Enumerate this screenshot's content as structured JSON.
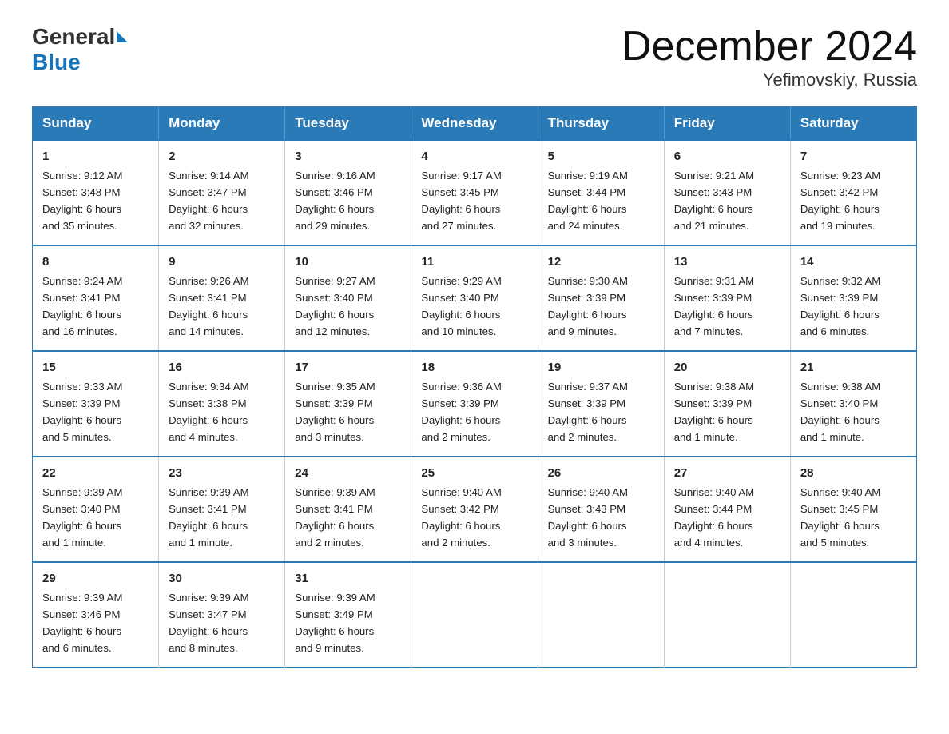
{
  "header": {
    "logo_general": "General",
    "logo_blue": "Blue",
    "month_title": "December 2024",
    "location": "Yefimovskiy, Russia"
  },
  "days_of_week": [
    "Sunday",
    "Monday",
    "Tuesday",
    "Wednesday",
    "Thursday",
    "Friday",
    "Saturday"
  ],
  "weeks": [
    [
      {
        "day": "1",
        "info": "Sunrise: 9:12 AM\nSunset: 3:48 PM\nDaylight: 6 hours\nand 35 minutes."
      },
      {
        "day": "2",
        "info": "Sunrise: 9:14 AM\nSunset: 3:47 PM\nDaylight: 6 hours\nand 32 minutes."
      },
      {
        "day": "3",
        "info": "Sunrise: 9:16 AM\nSunset: 3:46 PM\nDaylight: 6 hours\nand 29 minutes."
      },
      {
        "day": "4",
        "info": "Sunrise: 9:17 AM\nSunset: 3:45 PM\nDaylight: 6 hours\nand 27 minutes."
      },
      {
        "day": "5",
        "info": "Sunrise: 9:19 AM\nSunset: 3:44 PM\nDaylight: 6 hours\nand 24 minutes."
      },
      {
        "day": "6",
        "info": "Sunrise: 9:21 AM\nSunset: 3:43 PM\nDaylight: 6 hours\nand 21 minutes."
      },
      {
        "day": "7",
        "info": "Sunrise: 9:23 AM\nSunset: 3:42 PM\nDaylight: 6 hours\nand 19 minutes."
      }
    ],
    [
      {
        "day": "8",
        "info": "Sunrise: 9:24 AM\nSunset: 3:41 PM\nDaylight: 6 hours\nand 16 minutes."
      },
      {
        "day": "9",
        "info": "Sunrise: 9:26 AM\nSunset: 3:41 PM\nDaylight: 6 hours\nand 14 minutes."
      },
      {
        "day": "10",
        "info": "Sunrise: 9:27 AM\nSunset: 3:40 PM\nDaylight: 6 hours\nand 12 minutes."
      },
      {
        "day": "11",
        "info": "Sunrise: 9:29 AM\nSunset: 3:40 PM\nDaylight: 6 hours\nand 10 minutes."
      },
      {
        "day": "12",
        "info": "Sunrise: 9:30 AM\nSunset: 3:39 PM\nDaylight: 6 hours\nand 9 minutes."
      },
      {
        "day": "13",
        "info": "Sunrise: 9:31 AM\nSunset: 3:39 PM\nDaylight: 6 hours\nand 7 minutes."
      },
      {
        "day": "14",
        "info": "Sunrise: 9:32 AM\nSunset: 3:39 PM\nDaylight: 6 hours\nand 6 minutes."
      }
    ],
    [
      {
        "day": "15",
        "info": "Sunrise: 9:33 AM\nSunset: 3:39 PM\nDaylight: 6 hours\nand 5 minutes."
      },
      {
        "day": "16",
        "info": "Sunrise: 9:34 AM\nSunset: 3:38 PM\nDaylight: 6 hours\nand 4 minutes."
      },
      {
        "day": "17",
        "info": "Sunrise: 9:35 AM\nSunset: 3:39 PM\nDaylight: 6 hours\nand 3 minutes."
      },
      {
        "day": "18",
        "info": "Sunrise: 9:36 AM\nSunset: 3:39 PM\nDaylight: 6 hours\nand 2 minutes."
      },
      {
        "day": "19",
        "info": "Sunrise: 9:37 AM\nSunset: 3:39 PM\nDaylight: 6 hours\nand 2 minutes."
      },
      {
        "day": "20",
        "info": "Sunrise: 9:38 AM\nSunset: 3:39 PM\nDaylight: 6 hours\nand 1 minute."
      },
      {
        "day": "21",
        "info": "Sunrise: 9:38 AM\nSunset: 3:40 PM\nDaylight: 6 hours\nand 1 minute."
      }
    ],
    [
      {
        "day": "22",
        "info": "Sunrise: 9:39 AM\nSunset: 3:40 PM\nDaylight: 6 hours\nand 1 minute."
      },
      {
        "day": "23",
        "info": "Sunrise: 9:39 AM\nSunset: 3:41 PM\nDaylight: 6 hours\nand 1 minute."
      },
      {
        "day": "24",
        "info": "Sunrise: 9:39 AM\nSunset: 3:41 PM\nDaylight: 6 hours\nand 2 minutes."
      },
      {
        "day": "25",
        "info": "Sunrise: 9:40 AM\nSunset: 3:42 PM\nDaylight: 6 hours\nand 2 minutes."
      },
      {
        "day": "26",
        "info": "Sunrise: 9:40 AM\nSunset: 3:43 PM\nDaylight: 6 hours\nand 3 minutes."
      },
      {
        "day": "27",
        "info": "Sunrise: 9:40 AM\nSunset: 3:44 PM\nDaylight: 6 hours\nand 4 minutes."
      },
      {
        "day": "28",
        "info": "Sunrise: 9:40 AM\nSunset: 3:45 PM\nDaylight: 6 hours\nand 5 minutes."
      }
    ],
    [
      {
        "day": "29",
        "info": "Sunrise: 9:39 AM\nSunset: 3:46 PM\nDaylight: 6 hours\nand 6 minutes."
      },
      {
        "day": "30",
        "info": "Sunrise: 9:39 AM\nSunset: 3:47 PM\nDaylight: 6 hours\nand 8 minutes."
      },
      {
        "day": "31",
        "info": "Sunrise: 9:39 AM\nSunset: 3:49 PM\nDaylight: 6 hours\nand 9 minutes."
      },
      null,
      null,
      null,
      null
    ]
  ]
}
